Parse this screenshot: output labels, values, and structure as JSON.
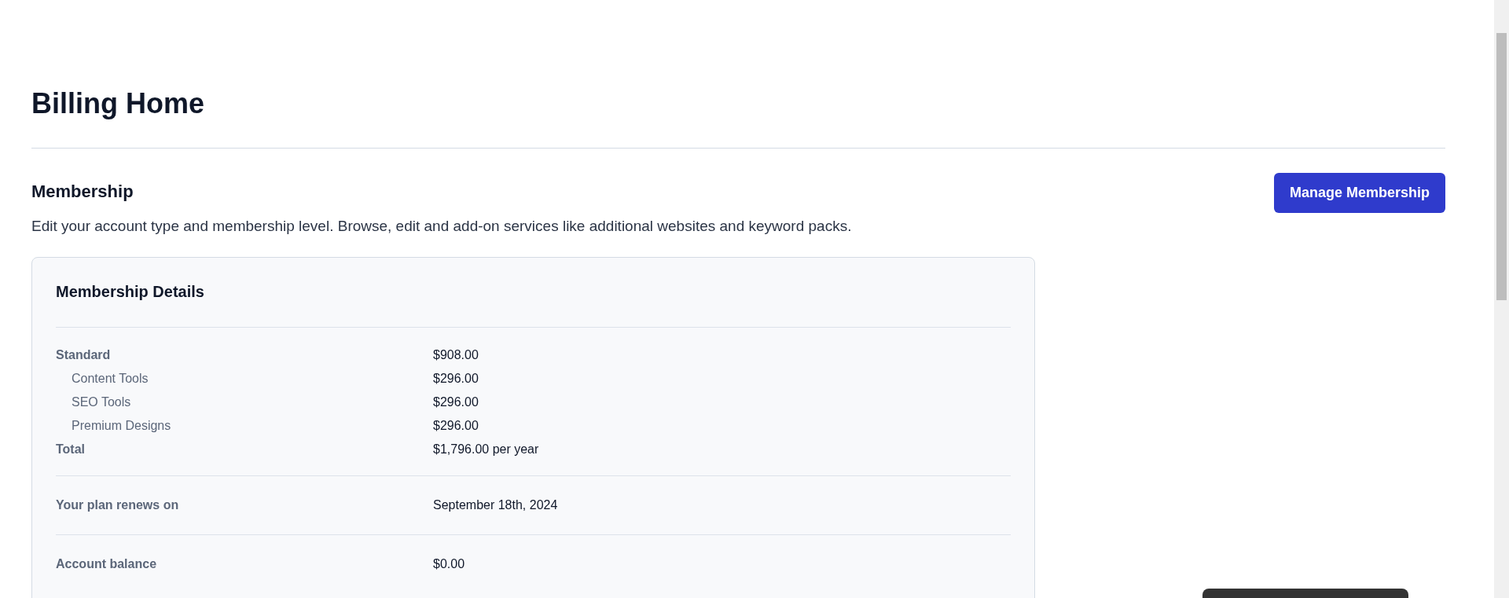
{
  "page": {
    "title": "Billing Home"
  },
  "membership": {
    "heading": "Membership",
    "button": "Manage Membership",
    "description": "Edit your account type and membership level. Browse, edit and add-on services like additional websites and keyword packs."
  },
  "details": {
    "title": "Membership Details",
    "lines": [
      {
        "kind": "main",
        "label": "Standard",
        "value": "$908.00"
      },
      {
        "kind": "addon",
        "label": "Content Tools",
        "value": "$296.00"
      },
      {
        "kind": "addon",
        "label": "SEO Tools",
        "value": "$296.00"
      },
      {
        "kind": "addon",
        "label": "Premium Designs",
        "value": "$296.00"
      },
      {
        "kind": "main",
        "label": "Total",
        "value": "$1,796.00 per year"
      }
    ],
    "sections": [
      {
        "label": "Your plan renews on",
        "value": "September 18th, 2024"
      },
      {
        "label": "Account balance",
        "value": "$0.00"
      }
    ]
  }
}
